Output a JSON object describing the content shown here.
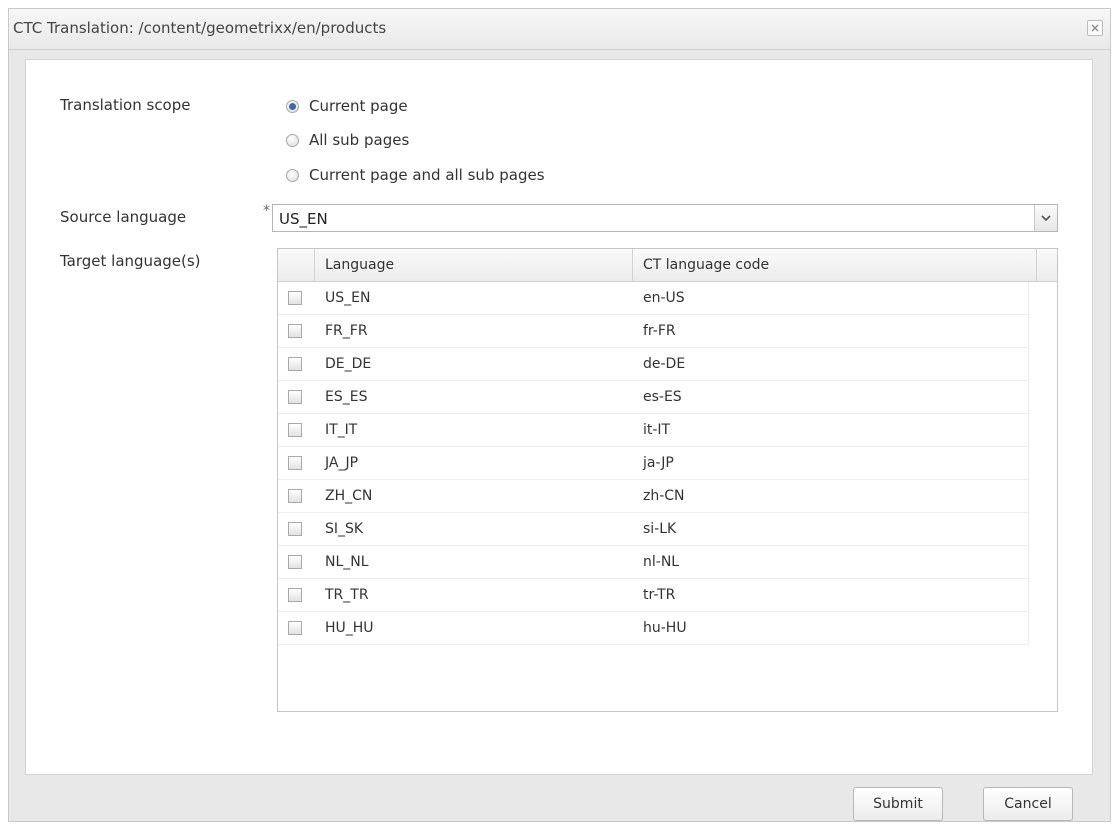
{
  "dialog": {
    "title": "CTC Translation: /content/geometrixx/en/products"
  },
  "scope": {
    "label": "Translation scope",
    "options": [
      {
        "label": "Current page",
        "checked": true
      },
      {
        "label": "All sub pages",
        "checked": false
      },
      {
        "label": "Current page and all sub pages",
        "checked": false
      }
    ]
  },
  "source": {
    "label": "Source language",
    "required_mark": "*",
    "value": "US_EN"
  },
  "target": {
    "label": "Target language(s)",
    "columns": {
      "language": "Language",
      "code": "CT language code"
    },
    "rows": [
      {
        "language": "US_EN",
        "code": "en-US"
      },
      {
        "language": "FR_FR",
        "code": "fr-FR"
      },
      {
        "language": "DE_DE",
        "code": "de-DE"
      },
      {
        "language": "ES_ES",
        "code": "es-ES"
      },
      {
        "language": "IT_IT",
        "code": "it-IT"
      },
      {
        "language": "JA_JP",
        "code": "ja-JP"
      },
      {
        "language": "ZH_CN",
        "code": "zh-CN"
      },
      {
        "language": "SI_SK",
        "code": "si-LK"
      },
      {
        "language": "NL_NL",
        "code": "nl-NL"
      },
      {
        "language": "TR_TR",
        "code": "tr-TR"
      },
      {
        "language": "HU_HU",
        "code": "hu-HU"
      }
    ]
  },
  "footer": {
    "submit_label": "Submit",
    "cancel_label": "Cancel"
  },
  "icons": {
    "close": "close-icon",
    "dropdown": "chevron-down-icon"
  },
  "colors": {
    "radio_selected": "#3c6ea3",
    "dialog_background": "#e8e8e8"
  }
}
